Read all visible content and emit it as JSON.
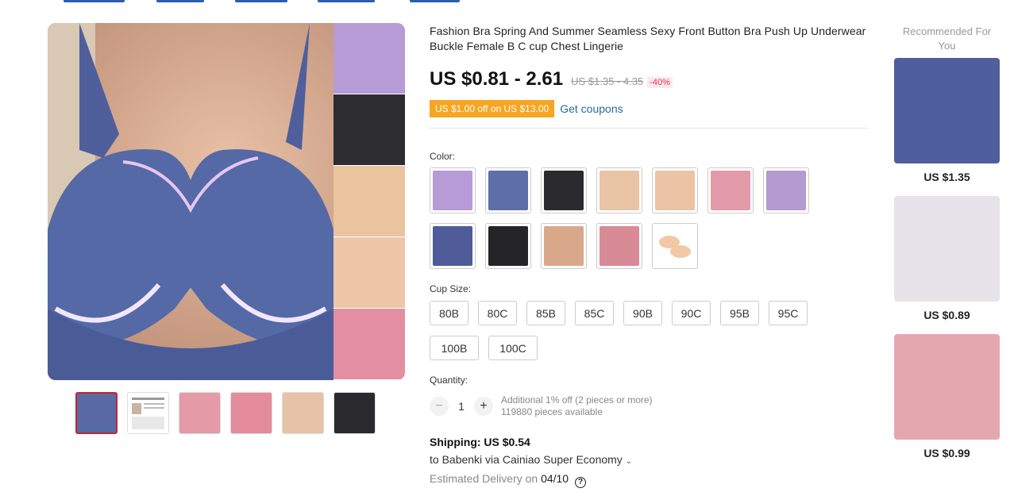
{
  "product": {
    "title": "Fashion Bra Spring And Summer Seamless Sexy Front Button Bra Push Up Underwear Buckle Female B C cup Chest Lingerie",
    "price": "US $0.81 - 2.61",
    "price_original": "US $1.35 - 4.35",
    "discount": "-40%",
    "coupon_badge": "US $1.00 off on US $13.00",
    "get_coupons": "Get coupons"
  },
  "variants": {
    "color_label": "Color:",
    "colors": [
      {
        "name": "purple",
        "hex": "#b79bd6"
      },
      {
        "name": "blue",
        "hex": "#5e6ea8"
      },
      {
        "name": "black",
        "hex": "#2b2b2e"
      },
      {
        "name": "skin",
        "hex": "#e8c4a4"
      },
      {
        "name": "beige",
        "hex": "#ecc3a4"
      },
      {
        "name": "pink",
        "hex": "#e39aa8"
      },
      {
        "name": "lavender",
        "hex": "#b49ad0"
      },
      {
        "name": "navy",
        "hex": "#4f5c99"
      },
      {
        "name": "black-2",
        "hex": "#252528"
      },
      {
        "name": "nude",
        "hex": "#d9a88a"
      },
      {
        "name": "rose",
        "hex": "#d88a96"
      },
      {
        "name": "nipple-pads",
        "hex": "#f1c9a4"
      }
    ],
    "cup_label": "Cup Size:",
    "cups": [
      "80B",
      "80C",
      "85B",
      "85C",
      "90B",
      "90C",
      "95B",
      "95C",
      "100B",
      "100C"
    ]
  },
  "quantity": {
    "label": "Quantity:",
    "minus": "−",
    "value": "1",
    "plus": "+",
    "note_line1": "Additional 1% off (2 pieces or more)",
    "note_line2": "119880 pieces available"
  },
  "shipping": {
    "title": "Shipping: US $0.54",
    "to": "to Babenki via Cainiao Super Economy",
    "chevron": "⌄",
    "delivery_prefix": "Estimated Delivery on",
    "delivery_date": "04/10",
    "help": "?"
  },
  "recommended": {
    "title": "Recommended For You",
    "items": [
      {
        "price": "US $1.35",
        "color": "#4f5e9c"
      },
      {
        "price": "US $0.89",
        "color": "#e6e3ea"
      },
      {
        "price": "US $0.99",
        "color": "#e4a7b0"
      }
    ]
  },
  "gallery": {
    "main_color": "#5469a6",
    "side_colors": [
      "#b79bd6",
      "#2d2d31",
      "#eac39f",
      "#eec6a8",
      "#e38fa1"
    ],
    "thumbs": [
      "#5a6aa6",
      "#ffffff",
      "#e59aa8",
      "#e48b9c",
      "#e7c2a6",
      "#2a2a2e"
    ]
  }
}
